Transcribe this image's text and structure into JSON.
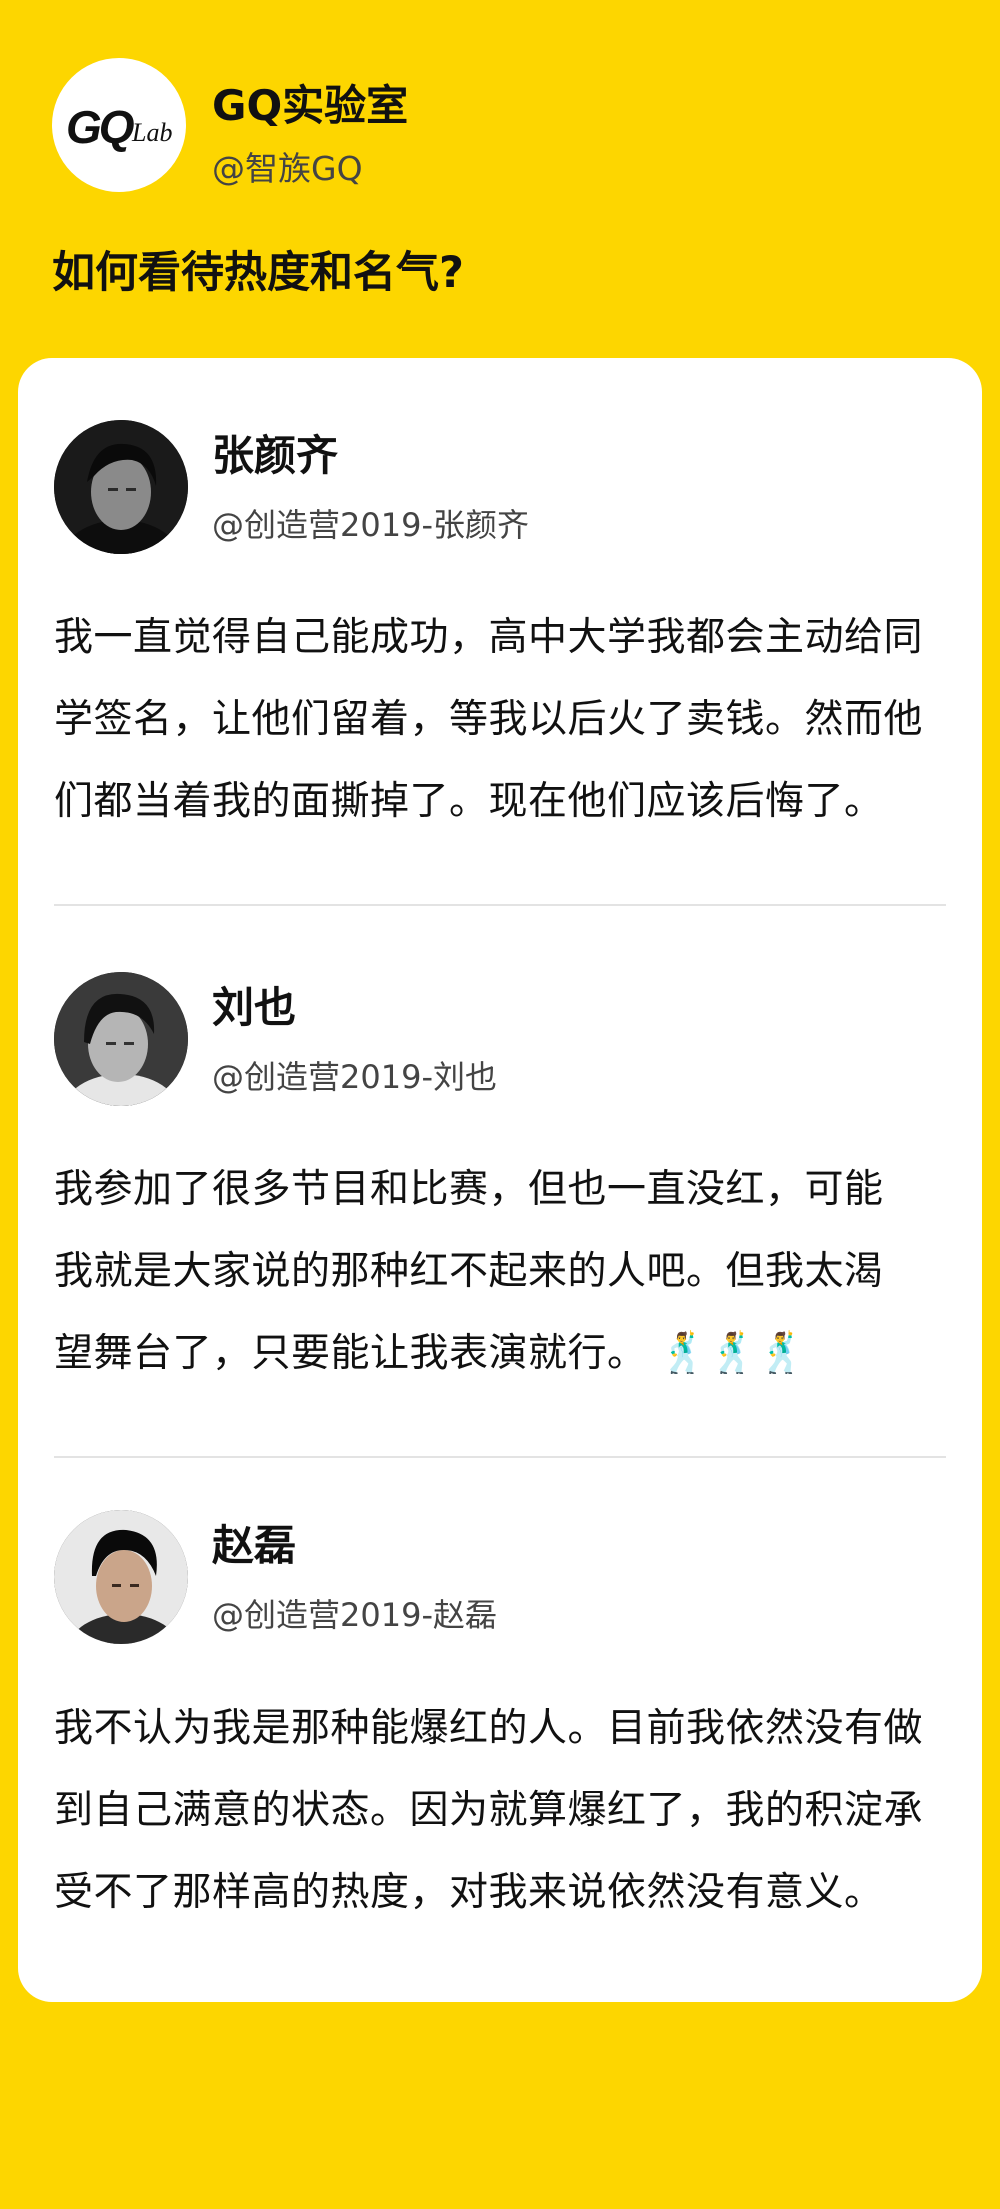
{
  "brand": {
    "logo_text_main": "GQ",
    "logo_text_sub": "Lab",
    "name": "GQ实验室",
    "handle": "@智族GQ"
  },
  "question": "如何看待热度和名气?",
  "colors": {
    "background": "#FDD600",
    "card": "#FFFFFF",
    "divider": "#E3E3E3"
  },
  "posts": [
    {
      "name": "张颜齐",
      "handle": "@创造营2019-张颜齐",
      "lines": [
        "我一直觉得自己能成功，高中大学我都会主动给同",
        "学签名，让他们留着，等我以后火了卖钱。然而他",
        "们都当着我的面撕掉了。现在他们应该后悔了。"
      ],
      "avatar_icon": "portrait-photo"
    },
    {
      "name": "刘也",
      "handle": "@创造营2019-刘也",
      "lines": [
        "我参加了很多节目和比赛，但也一直没红，可能",
        "我就是大家说的那种红不起来的人吧。但我太渴",
        "望舞台了，只要能让我表演就行。"
      ],
      "emoji": "🕺🕺🕺",
      "avatar_icon": "portrait-photo"
    },
    {
      "name": "赵磊",
      "handle": "@创造营2019-赵磊",
      "lines": [
        "我不认为我是那种能爆红的人。目前我依然没有做",
        "到自己满意的状态。因为就算爆红了，我的积淀承",
        "受不了那样高的热度，对我来说依然没有意义。"
      ],
      "avatar_icon": "portrait-photo"
    }
  ]
}
